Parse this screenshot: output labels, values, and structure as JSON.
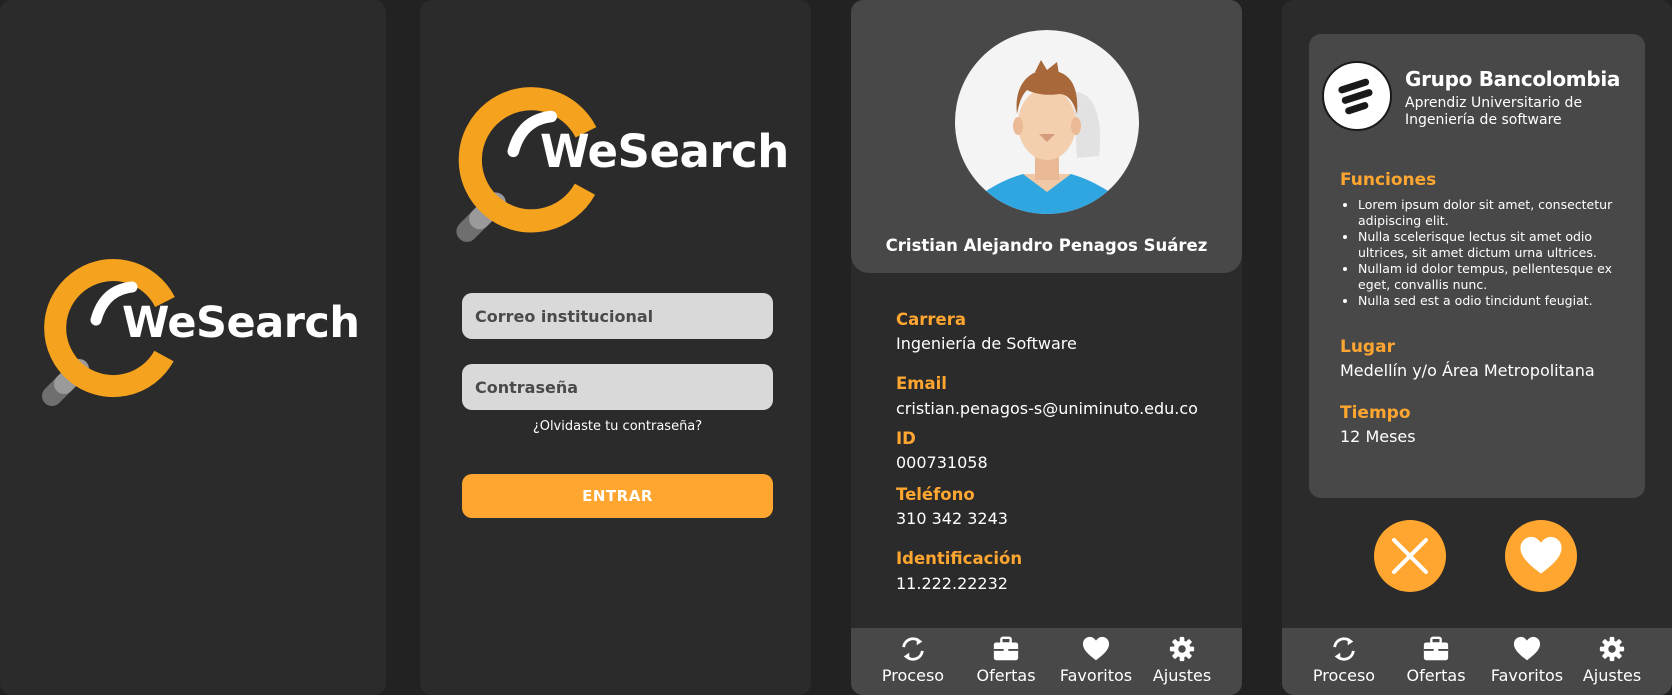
{
  "brand": {
    "name": "WeSearch",
    "accent_color": "#ffa630",
    "logo_icon": "magnifier-logo-icon"
  },
  "login": {
    "email_placeholder": "Correo institucional",
    "password_placeholder": "Contraseña",
    "forgot_label": "¿Olvidaste tu contraseña?",
    "submit_label": "ENTRAR"
  },
  "profile": {
    "name": "Cristian Alejandro Penagos Suárez",
    "fields": [
      {
        "label": "Carrera",
        "value": "Ingeniería de Software"
      },
      {
        "label": "Email",
        "value": "cristian.penagos-s@uniminuto.edu.co"
      },
      {
        "label": "ID",
        "value": "000731058"
      },
      {
        "label": "Teléfono",
        "value": "310 342 3243"
      },
      {
        "label": "Identificación",
        "value": "11.222.22232"
      }
    ]
  },
  "offer": {
    "company": "Grupo Bancolombia",
    "role": "Aprendiz Universitario de Ingeniería de software",
    "functions_label": "Funciones",
    "functions": [
      "Lorem ipsum dolor sit amet, consectetur adipiscing elit.",
      "Nulla scelerisque lectus sit amet odio ultrices, sit amet dictum urna ultrices.",
      "Nullam id dolor tempus, pellentesque ex eget, convallis nunc.",
      "Nulla sed est a odio tincidunt feugiat."
    ],
    "place_label": "Lugar",
    "place": "Medellín y/o Área Metropolitana",
    "time_label": "Tiempo",
    "time": "12 Meses"
  },
  "nav": {
    "items": [
      {
        "label": "Proceso",
        "icon": "refresh-icon"
      },
      {
        "label": "Ofertas",
        "icon": "briefcase-icon"
      },
      {
        "label": "Favoritos",
        "icon": "heart-icon"
      },
      {
        "label": "Ajustes",
        "icon": "gear-icon"
      }
    ]
  }
}
